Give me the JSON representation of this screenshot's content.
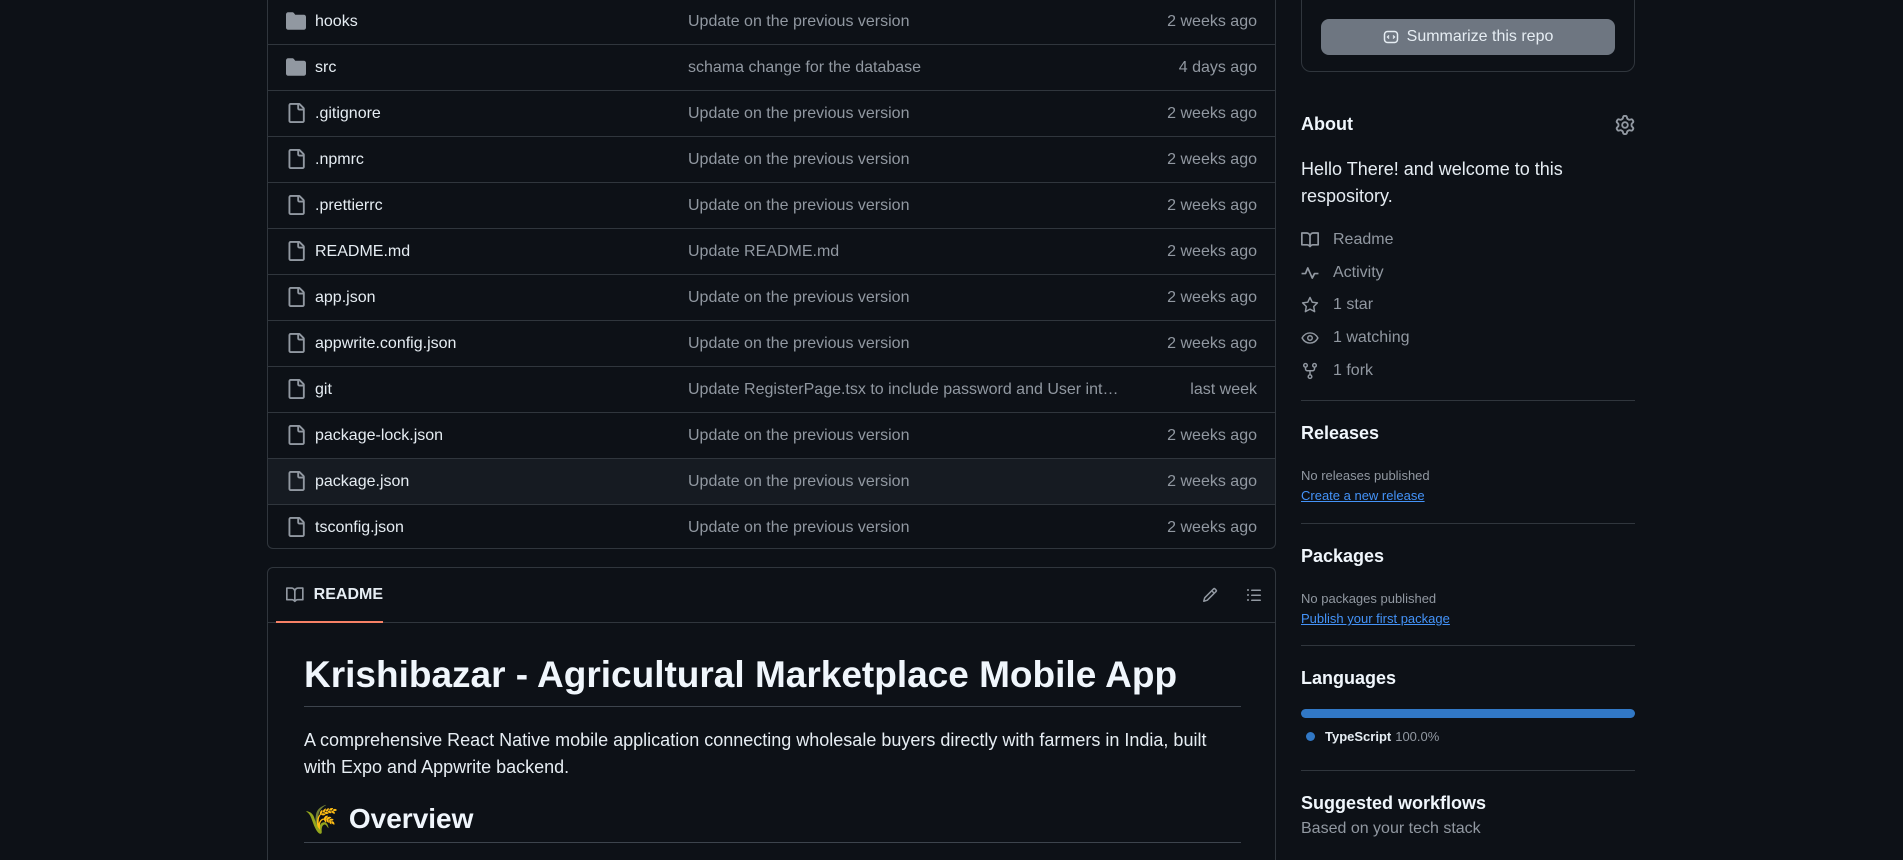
{
  "files": [
    {
      "name": "hooks",
      "type": "folder",
      "message": "Update on the previous version",
      "age": "2 weeks ago"
    },
    {
      "name": "src",
      "type": "folder",
      "message": "schama change for the database",
      "age": "4 days ago"
    },
    {
      "name": ".gitignore",
      "type": "file",
      "message": "Update on the previous version",
      "age": "2 weeks ago"
    },
    {
      "name": ".npmrc",
      "type": "file",
      "message": "Update on the previous version",
      "age": "2 weeks ago"
    },
    {
      "name": ".prettierrc",
      "type": "file",
      "message": "Update on the previous version",
      "age": "2 weeks ago"
    },
    {
      "name": "README.md",
      "type": "file",
      "message": "Update README.md",
      "age": "2 weeks ago"
    },
    {
      "name": "app.json",
      "type": "file",
      "message": "Update on the previous version",
      "age": "2 weeks ago"
    },
    {
      "name": "appwrite.config.json",
      "type": "file",
      "message": "Update on the previous version",
      "age": "2 weeks ago"
    },
    {
      "name": "git",
      "type": "file",
      "message": "Update RegisterPage.tsx to include password and User interf...",
      "age": "last week"
    },
    {
      "name": "package-lock.json",
      "type": "file",
      "message": "Update on the previous version",
      "age": "2 weeks ago"
    },
    {
      "name": "package.json",
      "type": "file",
      "message": "Update on the previous version",
      "age": "2 weeks ago"
    },
    {
      "name": "tsconfig.json",
      "type": "file",
      "message": "Update on the previous version",
      "age": "2 weeks ago"
    }
  ],
  "readme": {
    "tab_label": "README",
    "title": "Krishibazar - Agricultural Marketplace Mobile App",
    "description": "A comprehensive React Native mobile application connecting wholesale buyers directly with farmers in India, built with Expo and Appwrite backend.",
    "overview_emoji": "🌾",
    "overview_heading": "Overview"
  },
  "sidebar": {
    "summarize_label": "Summarize this repo",
    "about_title": "About",
    "about_desc": "Hello There! and welcome to this respository.",
    "readme_link": "Readme",
    "activity_link": "Activity",
    "stars": "1 star",
    "watching": "1 watching",
    "forks": "1 fork",
    "releases_title": "Releases",
    "releases_none": "No releases published",
    "releases_link": "Create a new release",
    "packages_title": "Packages",
    "packages_none": "No packages published",
    "packages_link": "Publish your first package",
    "languages_title": "Languages",
    "languages": [
      {
        "name": "TypeScript",
        "percent": "100.0%",
        "color": "#3178c6"
      }
    ],
    "workflows_title": "Suggested workflows",
    "workflows_sub": "Based on your tech stack"
  },
  "colors": {
    "accent_tab": "#f78166",
    "link": "#4493f8",
    "background": "#0d1117"
  }
}
